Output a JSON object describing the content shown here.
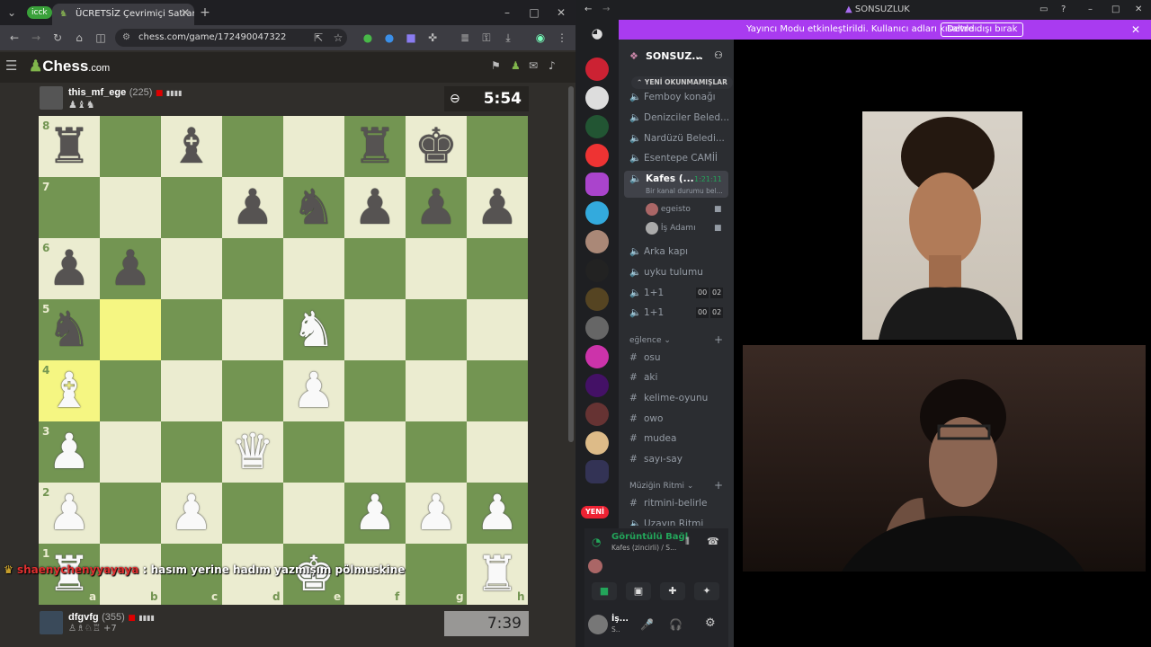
{
  "browser": {
    "profile_badge": "icck",
    "tab_title": "ÜCRETSİZ Çevrimiçi Satranç Oyu",
    "url": "chess.com/game/172490047322",
    "window_controls": [
      "–",
      "□",
      "✕"
    ]
  },
  "chess": {
    "logo_text": "Chess",
    "logo_suffix": ".com",
    "top_player": {
      "name": "this_mf_ege",
      "rating": "(225)",
      "clock": "5:54"
    },
    "bottom_player": {
      "name": "dfgvfg",
      "rating": "(355)",
      "clock": "7:39",
      "captured_extra": "+7"
    },
    "ranks": [
      "8",
      "7",
      "6",
      "5",
      "4",
      "3",
      "2",
      "1"
    ],
    "files": [
      "a",
      "b",
      "c",
      "d",
      "e",
      "f",
      "g",
      "h"
    ],
    "highlight_squares": [
      "b5",
      "a4"
    ],
    "pieces": [
      {
        "sq": "a8",
        "glyph": "♜",
        "color": "black"
      },
      {
        "sq": "c8",
        "glyph": "♝",
        "color": "black"
      },
      {
        "sq": "f8",
        "glyph": "♜",
        "color": "black"
      },
      {
        "sq": "g8",
        "glyph": "♚",
        "color": "black"
      },
      {
        "sq": "d7",
        "glyph": "♟",
        "color": "black"
      },
      {
        "sq": "e7",
        "glyph": "♞",
        "color": "black"
      },
      {
        "sq": "f7",
        "glyph": "♟",
        "color": "black"
      },
      {
        "sq": "g7",
        "glyph": "♟",
        "color": "black"
      },
      {
        "sq": "h7",
        "glyph": "♟",
        "color": "black"
      },
      {
        "sq": "a6",
        "glyph": "♟",
        "color": "black"
      },
      {
        "sq": "b6",
        "glyph": "♟",
        "color": "black"
      },
      {
        "sq": "a5",
        "glyph": "♞",
        "color": "black"
      },
      {
        "sq": "e5",
        "glyph": "♞",
        "color": "white"
      },
      {
        "sq": "a4",
        "glyph": "♝",
        "color": "white"
      },
      {
        "sq": "e4",
        "glyph": "♟",
        "color": "white"
      },
      {
        "sq": "d3",
        "glyph": "♛",
        "color": "white"
      },
      {
        "sq": "a3",
        "glyph": "♟",
        "color": "white"
      },
      {
        "sq": "a2",
        "glyph": "♟",
        "color": "white"
      },
      {
        "sq": "c2",
        "glyph": "♟",
        "color": "white"
      },
      {
        "sq": "f2",
        "glyph": "♟",
        "color": "white"
      },
      {
        "sq": "g2",
        "glyph": "♟",
        "color": "white"
      },
      {
        "sq": "h2",
        "glyph": "♟",
        "color": "white"
      },
      {
        "sq": "a1",
        "glyph": "♜",
        "color": "white"
      },
      {
        "sq": "e1",
        "glyph": "♚",
        "color": "white"
      },
      {
        "sq": "h1",
        "glyph": "♜",
        "color": "white"
      }
    ],
    "colors": {
      "light": "#ebecd0",
      "dark": "#739552",
      "highlight": "#f5f682"
    }
  },
  "stream_chat": {
    "user": "shaenychenyyayaya",
    "message": " hasım yerine hadım yazmışım pölmuskine"
  },
  "discord": {
    "window_title": "SONSUZLUK",
    "banner": {
      "text": "Yayıncı Modu etkinleştirildi. Kullanıcı adları kısaltıldı.",
      "button": "Devre dışı bırak"
    },
    "guild_name": "SONSUZ...",
    "unread_pill": "YENİ OKUNMAMIŞLAR",
    "voice_channels": [
      {
        "name": "Femboy konağı"
      },
      {
        "name": "Denizciler Beled..."
      },
      {
        "name": "Nardüzü Beledi..."
      },
      {
        "name": "Esentepe CAMİİ"
      },
      {
        "name": "Kafes (...",
        "timer": "1:21:11",
        "status": "Bir kanal durumu bel..."
      },
      {
        "name": "Arka kapı"
      },
      {
        "name": "uyku tulumu"
      },
      {
        "name": "1+1",
        "counts": [
          "00",
          "02"
        ]
      },
      {
        "name": "1+1",
        "counts": [
          "00",
          "02"
        ]
      }
    ],
    "voice_members": [
      "egeisto",
      "İş Adamı"
    ],
    "category_eglence": "eğlence",
    "text_channels": [
      "osu",
      "aki",
      "kelime-oyunu",
      "owo",
      "mudea",
      "sayı-say"
    ],
    "category_muzik": "Müziğin Ritmi",
    "music_channels": [
      "ritmini-belirle",
      "Uzayın Ritmi"
    ],
    "new_badge": "YENİ",
    "voice_connected": {
      "title": "Görüntülü Bağl",
      "subtitle": "Kafes (zincirli) / S..."
    },
    "user_short": "İş...",
    "user_sub": "S.."
  }
}
